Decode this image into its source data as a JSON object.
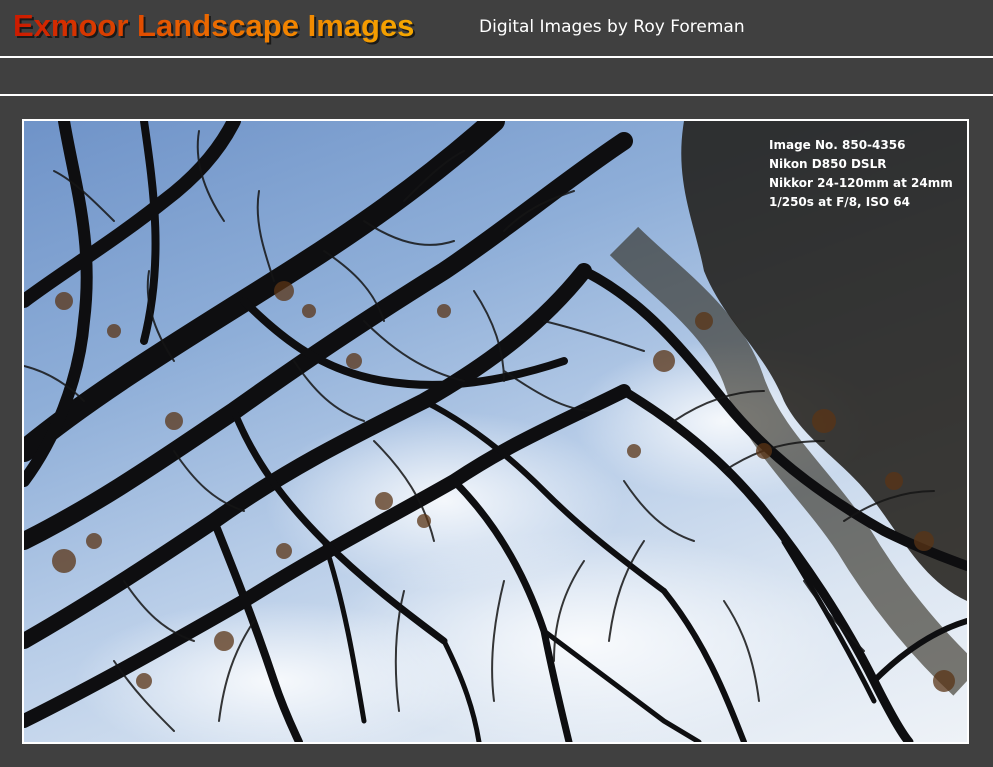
{
  "header": {
    "title": "Exmoor Landscape Images",
    "subtitle": "Digital Images by Roy Foreman"
  },
  "photo": {
    "subject": "tree-canopy-photo",
    "caption": [
      "Image No. 850-4356",
      "Nikon D850 DSLR",
      "Nikkor 24-120mm at 24mm",
      "1/250s at F/8, ISO 64"
    ]
  }
}
